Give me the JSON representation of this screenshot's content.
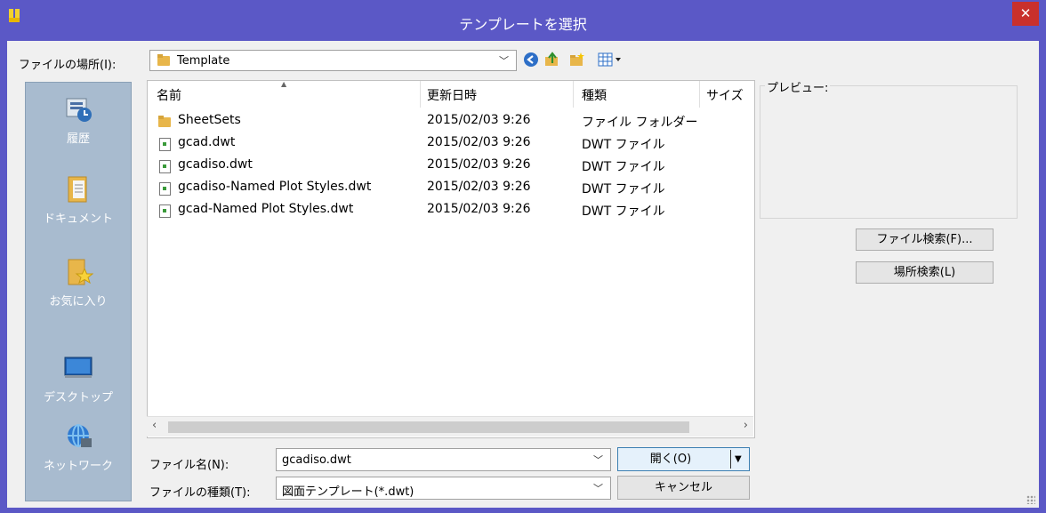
{
  "window": {
    "title": "テンプレートを選択",
    "close_glyph": "✕"
  },
  "toolbar": {
    "location_label": "ファイルの場所(I):",
    "location_value": "Template",
    "icons": [
      "back-icon",
      "up-folder-icon",
      "new-folder-icon",
      "view-menu-icon"
    ]
  },
  "places": [
    {
      "label": "履歴",
      "icon": "history-icon"
    },
    {
      "label": "ドキュメント",
      "icon": "documents-icon"
    },
    {
      "label": "お気に入り",
      "icon": "favorites-icon"
    },
    {
      "label": "デスクトップ",
      "icon": "desktop-icon"
    },
    {
      "label": "ネットワーク",
      "icon": "network-icon"
    }
  ],
  "filelist": {
    "columns": [
      "名前",
      "更新日時",
      "種類",
      "サイズ"
    ],
    "rows": [
      {
        "name": "SheetSets",
        "date": "2015/02/03 9:26",
        "type": "ファイル フォルダー",
        "icon": "folder-icon"
      },
      {
        "name": "gcad.dwt",
        "date": "2015/02/03 9:26",
        "type": "DWT ファイル",
        "icon": "dwt-file-icon"
      },
      {
        "name": "gcadiso.dwt",
        "date": "2015/02/03 9:26",
        "type": "DWT ファイル",
        "icon": "dwt-file-icon"
      },
      {
        "name": "gcadiso-Named Plot Styles.dwt",
        "date": "2015/02/03 9:26",
        "type": "DWT ファイル",
        "icon": "dwt-file-icon"
      },
      {
        "name": "gcad-Named Plot Styles.dwt",
        "date": "2015/02/03 9:26",
        "type": "DWT ファイル",
        "icon": "dwt-file-icon"
      }
    ]
  },
  "preview": {
    "label": "プレビュー:"
  },
  "buttons": {
    "find_file": "ファイル検索(F)...",
    "locate": "場所検索(L)",
    "open": "開く(O)",
    "cancel": "キャンセル"
  },
  "form": {
    "filename_label": "ファイル名(N):",
    "filename_value": "gcadiso.dwt",
    "filetype_label": "ファイルの種類(T):",
    "filetype_value": "図面テンプレート(*.dwt)"
  },
  "colors": {
    "titlebar": "#5b58c6",
    "close": "#c9302c",
    "places_bg": "#a8bbcf"
  }
}
